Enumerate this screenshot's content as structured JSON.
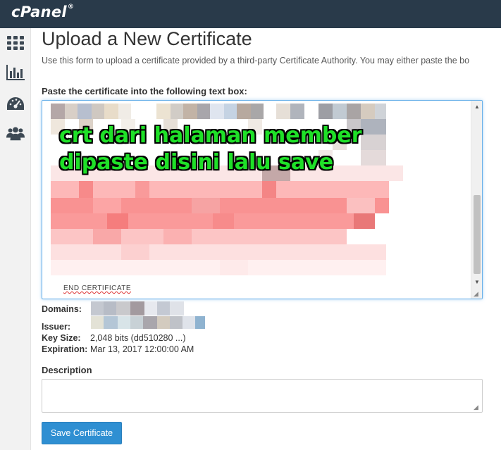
{
  "header": {
    "logo": "cPanel",
    "logo_mark": "®"
  },
  "sidebar": {
    "items": [
      {
        "icon": "grid-icon"
      },
      {
        "icon": "bar-chart-icon"
      },
      {
        "icon": "speedometer-icon"
      },
      {
        "icon": "users-icon"
      }
    ]
  },
  "page": {
    "title": "Upload a New Certificate",
    "intro": "Use this form to upload a certificate provided by a third-party Certificate Authority. You may either paste the bo"
  },
  "certificate": {
    "label": "Paste the certificate into the following text box:",
    "end_marker": "END CERTIFICATE",
    "annotation_line1": "crt dari halaman member",
    "annotation_line2": "dipaste disini lalu save"
  },
  "details": {
    "domains_label": "Domains:",
    "issuer_label": "Issuer:",
    "keysize_label": "Key Size:",
    "keysize_value": "2,048 bits (dd510280 ...)",
    "expiration_label": "Expiration:",
    "expiration_value": "Mar 13, 2017 12:00:00 AM"
  },
  "description": {
    "label": "Description",
    "value": ""
  },
  "actions": {
    "save_label": "Save Certificate"
  },
  "colors": {
    "topbar": "#293a4a",
    "primary_button": "#2f8fd2",
    "annotation": "#1fe028"
  }
}
